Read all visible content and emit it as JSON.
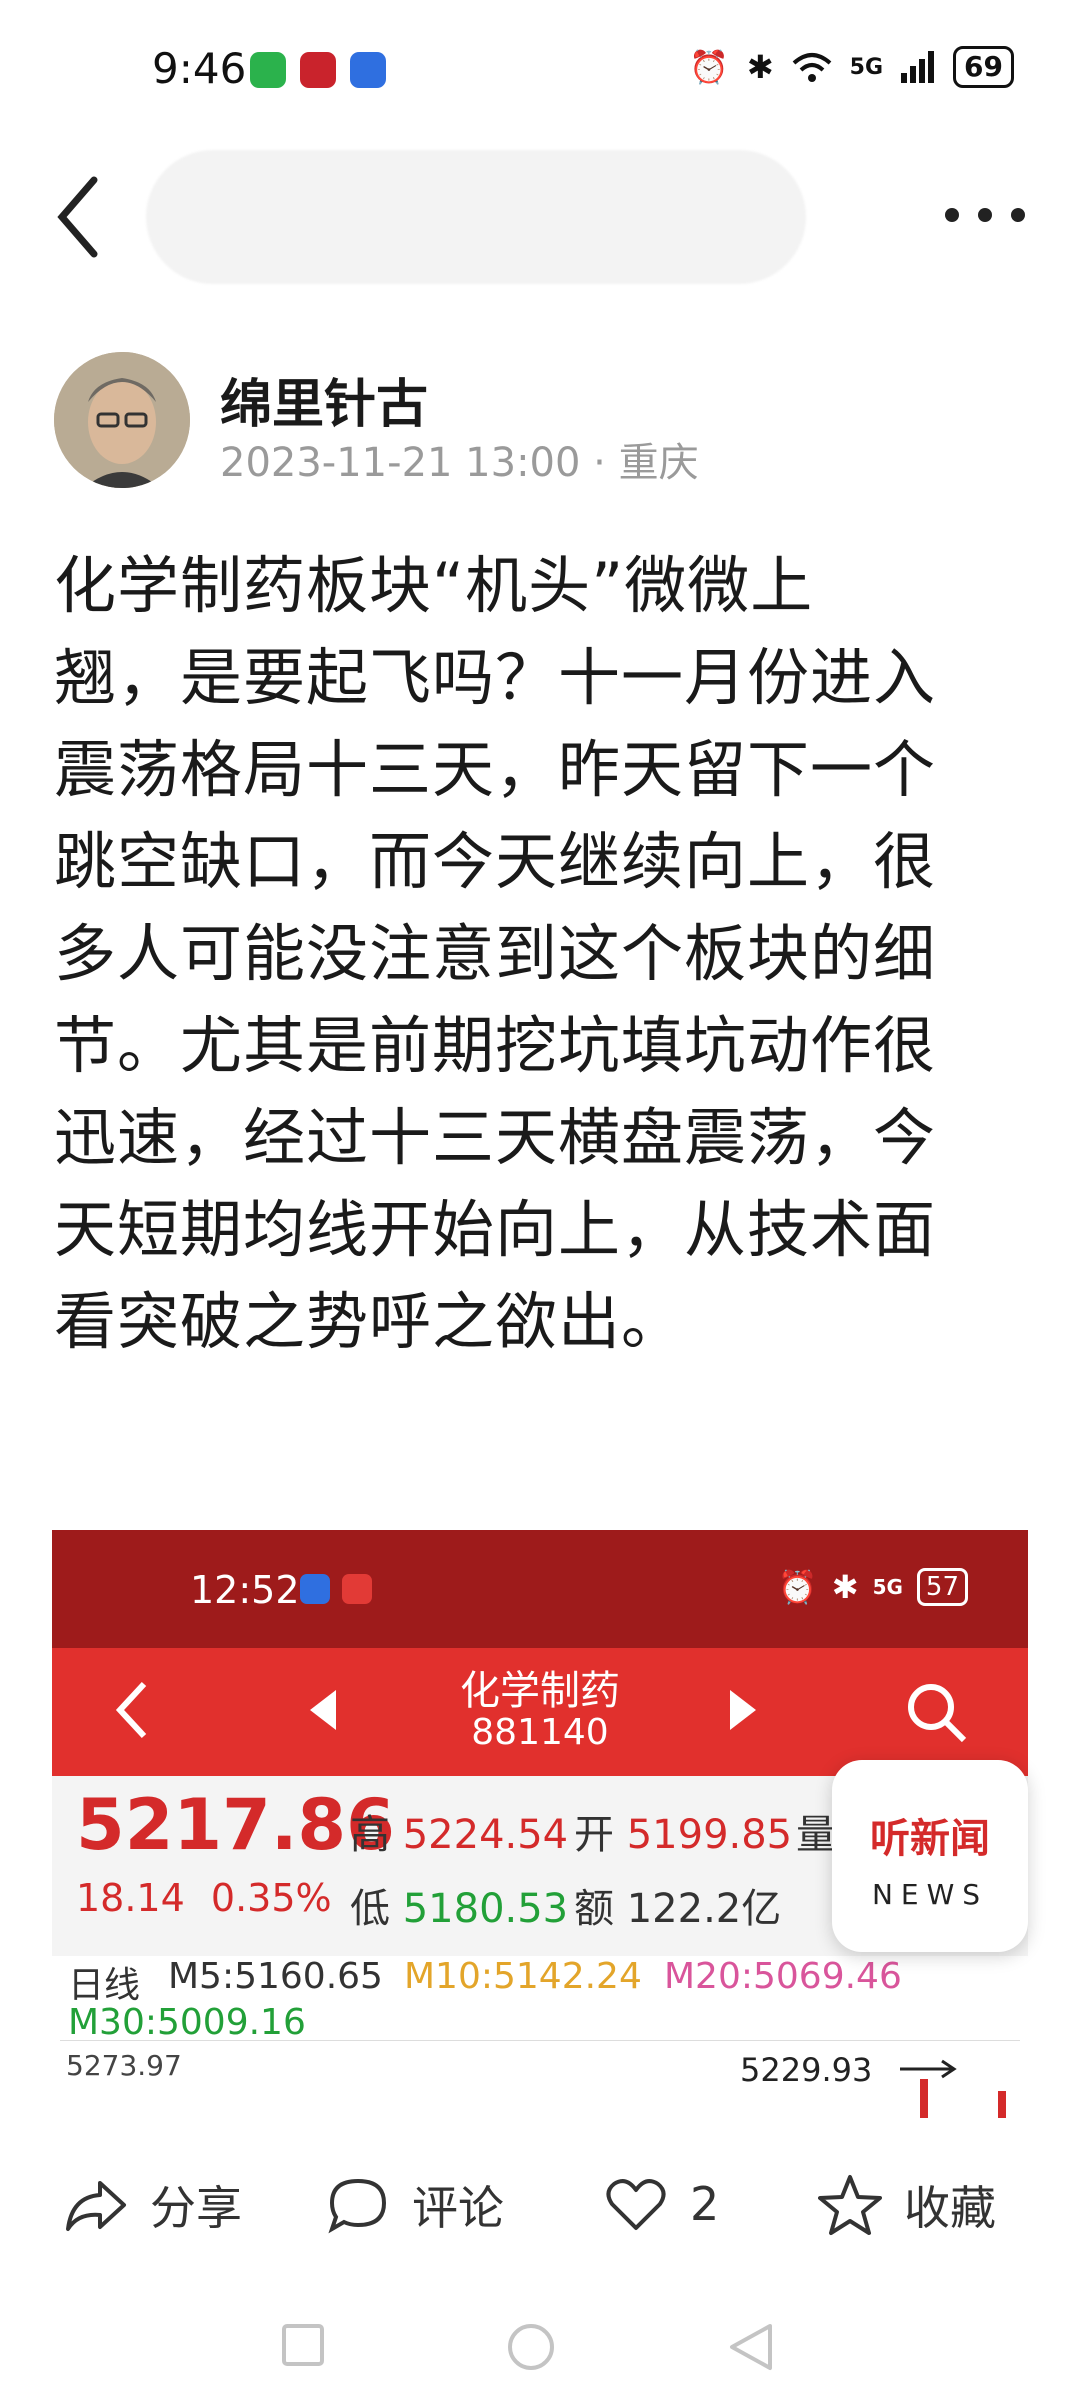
{
  "status_bar": {
    "time": "9:46",
    "battery": "69",
    "network": "5G"
  },
  "author": {
    "name": "绵里针古",
    "date": "2023-11-21 13:00",
    "location": "重庆",
    "separator": "·"
  },
  "post": {
    "lines": [
      "化学制药板块“机头”微微上",
      "翘，是要起飞吗？十一月份进入",
      "震荡格局十三天，昨天留下一个",
      "跳空缺口，而今天继续向上，很",
      "多人可能没注意到这个板块的细",
      "节。尤其是前期挖坑填坑动作很",
      "迅速，经过十三天横盘震荡，今",
      "天短期均线开始向上，从技术面",
      "看突破之势呼之欲出。"
    ]
  },
  "embedded_screenshot": {
    "time": "12:52",
    "battery": "57",
    "network": "5G",
    "title": "化学制药",
    "code": "881140",
    "price": "5217.86",
    "change": "18.14",
    "change_pct": "0.35%",
    "high_label": "高",
    "high": "5224.54",
    "open_label": "开",
    "open": "5199.85",
    "vol_label": "量",
    "low_label": "低",
    "low": "5180.53",
    "amount_label": "额",
    "amount": "122.2亿",
    "period": "日线",
    "ma5": "M5:5160.65",
    "ma10": "M10:5142.24",
    "ma20": "M20:5069.46",
    "ma30": "M30:5009.16",
    "chart_high": "5273.97",
    "chart_max": "5229.93"
  },
  "news_badge": {
    "cn": "听新闻",
    "en": "NEWS"
  },
  "actions": {
    "share": "分享",
    "comment": "评论",
    "like_count": "2",
    "collect": "收藏"
  },
  "colors": {
    "accent_red": "#d42a2a",
    "header_red": "#e1302d",
    "status_red": "#9e1b1b",
    "green": "#22a038"
  }
}
